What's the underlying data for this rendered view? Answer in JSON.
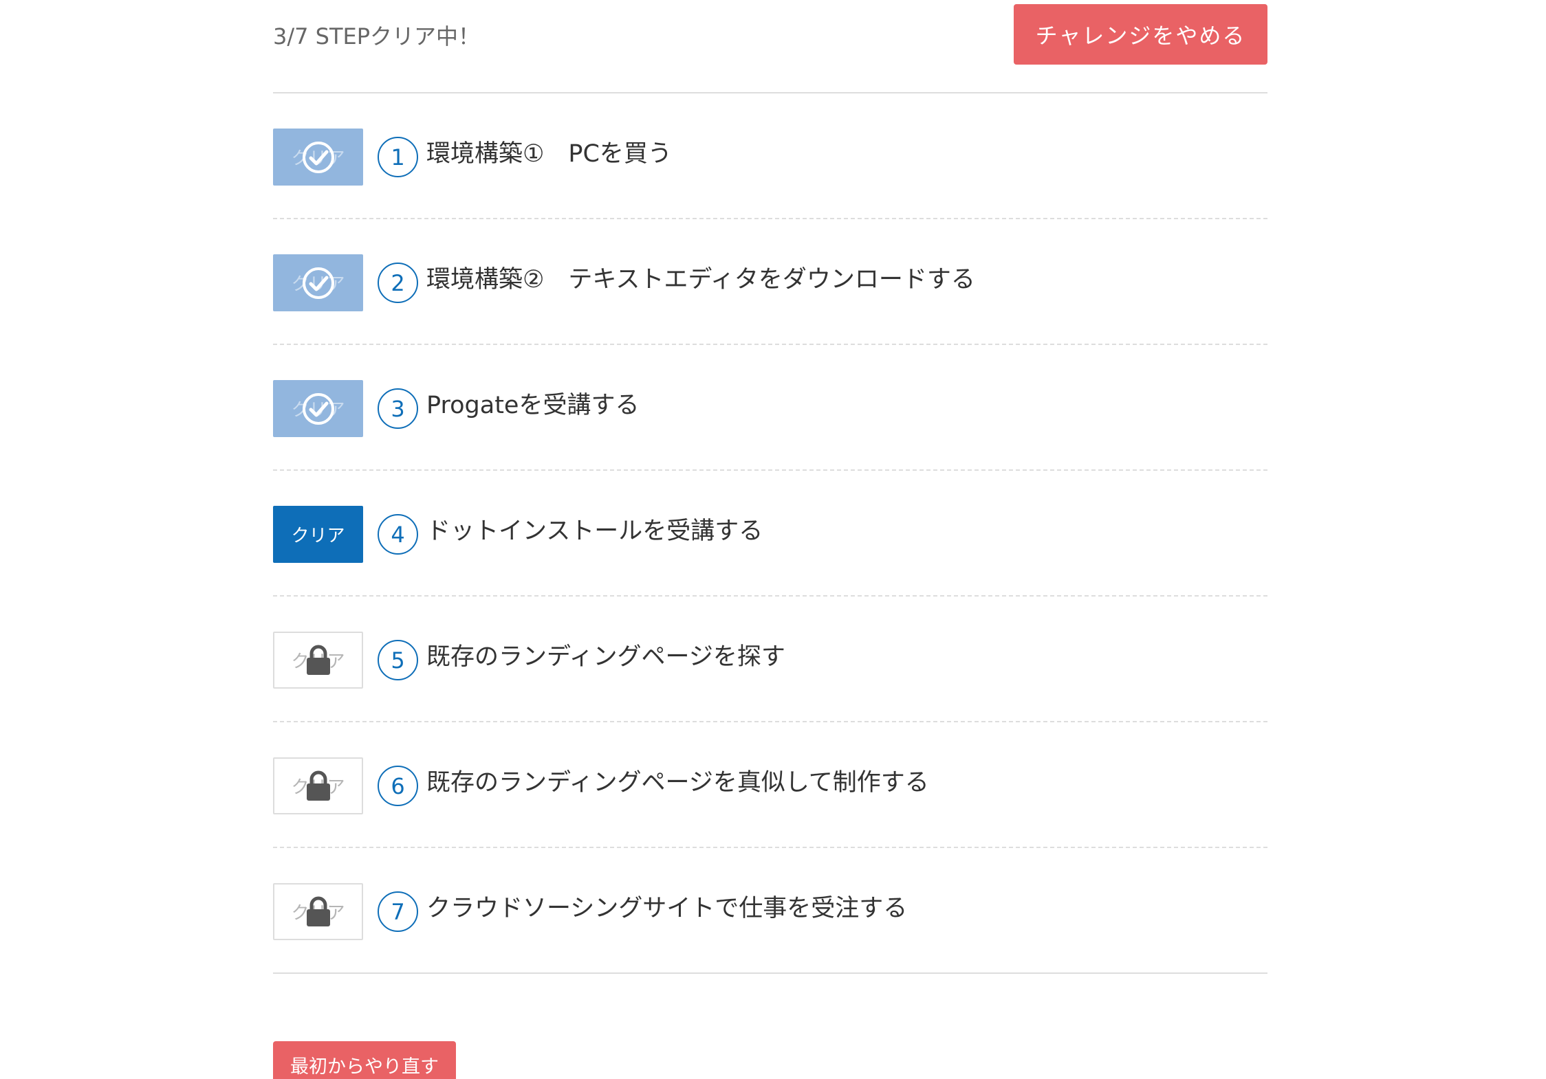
{
  "header": {
    "progress": "3/7 STEPクリア中！",
    "quit_label": "チャレンジをやめる"
  },
  "colors": {
    "accent_blue": "#0e6eb8",
    "done_blue": "#92b6de",
    "danger_red": "#e96265"
  },
  "steps": [
    {
      "number": "1",
      "title": "環境構築①　PCを買う",
      "status": "done",
      "button_label": "クリア",
      "icon": "check-circle-icon"
    },
    {
      "number": "2",
      "title": "環境構築②　テキストエディタをダウンロードする",
      "status": "done",
      "button_label": "クリア",
      "icon": "check-circle-icon"
    },
    {
      "number": "3",
      "title": "Progateを受講する",
      "status": "done",
      "button_label": "クリア",
      "icon": "check-circle-icon"
    },
    {
      "number": "4",
      "title": "ドットインストールを受講する",
      "status": "active",
      "button_label": "クリア",
      "icon": ""
    },
    {
      "number": "5",
      "title": "既存のランディングページを探す",
      "status": "locked",
      "button_label": "クリア",
      "icon": "lock-icon"
    },
    {
      "number": "6",
      "title": "既存のランディングページを真似して制作する",
      "status": "locked",
      "button_label": "クリア",
      "icon": "lock-icon"
    },
    {
      "number": "7",
      "title": "クラウドソーシングサイトで仕事を受注する",
      "status": "locked",
      "button_label": "クリア",
      "icon": "lock-icon"
    }
  ],
  "footer": {
    "restart_label": "最初からやり直す"
  }
}
